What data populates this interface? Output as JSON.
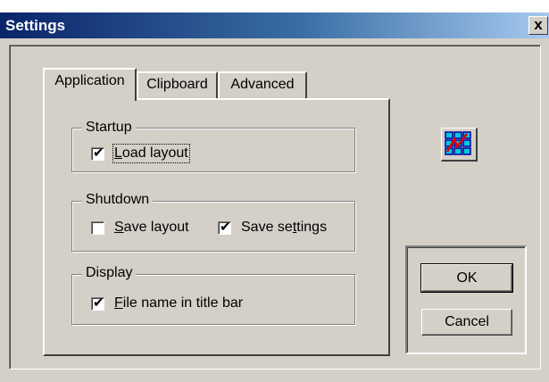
{
  "window": {
    "title": "Settings",
    "close_glyph": "x"
  },
  "tabs": [
    {
      "label": "Application",
      "active": true
    },
    {
      "label": "Clipboard",
      "active": false
    },
    {
      "label": "Advanced",
      "active": false
    }
  ],
  "groups": {
    "startup": {
      "legend": "Startup",
      "load_layout": {
        "label_u": "L",
        "label_rest": "oad layout",
        "checked": true,
        "check_glyph": "✔"
      }
    },
    "shutdown": {
      "legend": "Shutdown",
      "save_layout": {
        "label_u": "S",
        "label_rest": "ave layout",
        "checked": false
      },
      "save_settings": {
        "label_pre": "Save se",
        "label_u": "t",
        "label_rest": "tings",
        "checked": true,
        "check_glyph": "✔"
      }
    },
    "display": {
      "legend": "Display",
      "file_name_title": {
        "label_u": "F",
        "label_rest": "ile name in title bar",
        "checked": true,
        "check_glyph": "✔"
      }
    }
  },
  "buttons": {
    "ok": "OK",
    "cancel": "Cancel"
  },
  "icon": {
    "name": "app-grid-icon",
    "colors": {
      "cells": "#00c8d8",
      "cell_border": "#0000a0",
      "stroke": "#e00000"
    }
  }
}
